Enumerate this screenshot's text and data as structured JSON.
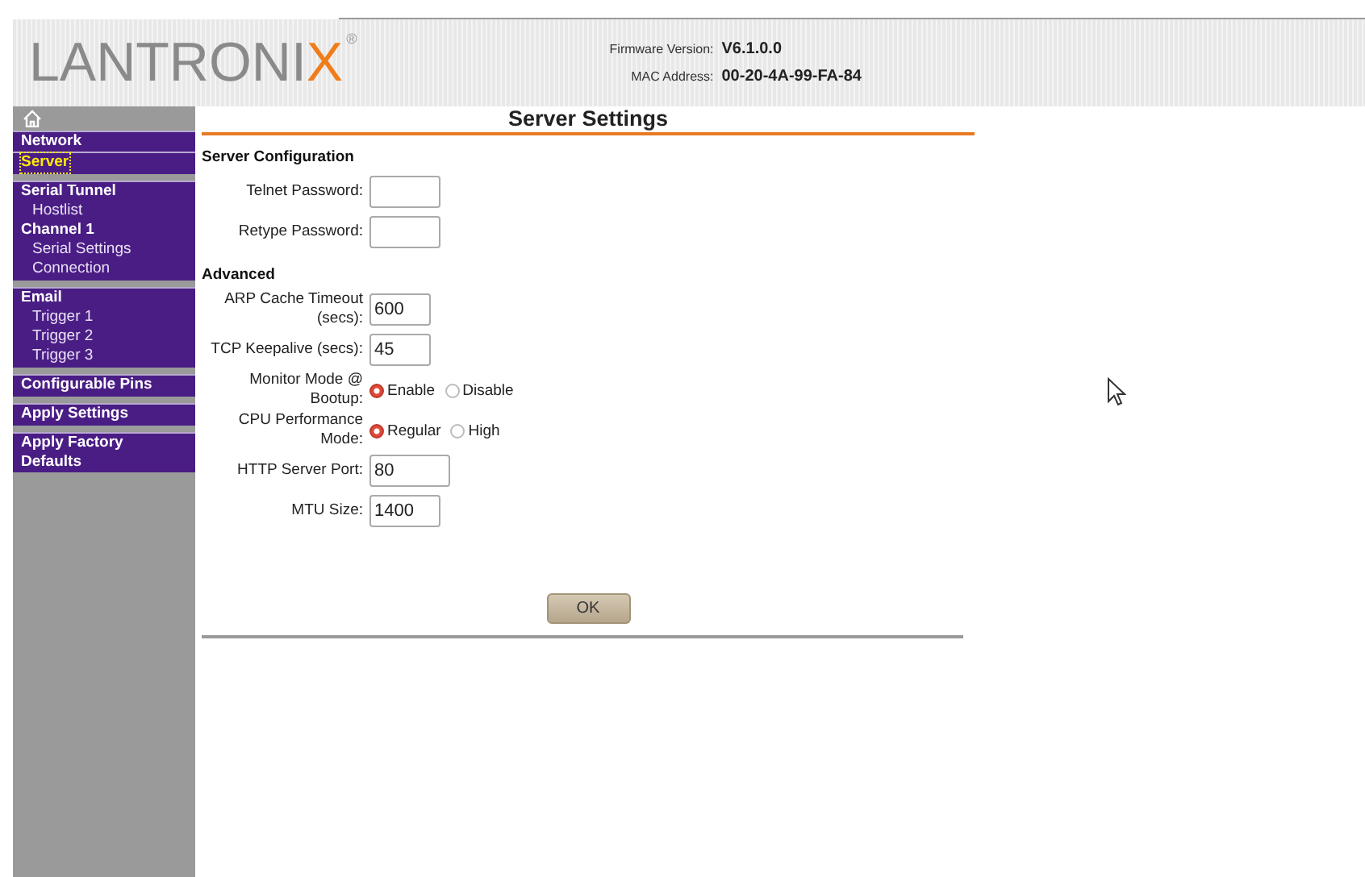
{
  "logo": {
    "text": "LANTRONI",
    "accent": "X",
    "mark": "®"
  },
  "device_info": [
    {
      "label": "Firmware Version:",
      "value": "V6.1.0.0"
    },
    {
      "label": "MAC Address:",
      "value": "00-20-4A-99-FA-84"
    }
  ],
  "sidebar": {
    "sections": [
      {
        "items": [
          {
            "label": "Network",
            "kind": "heading",
            "selected": false
          },
          {
            "label": "Server",
            "kind": "heading",
            "selected": true
          }
        ]
      },
      {
        "items": [
          {
            "label": "Serial Tunnel",
            "kind": "heading",
            "selected": false
          },
          {
            "label": "Hostlist",
            "kind": "sub",
            "selected": false
          },
          {
            "label": "Channel 1",
            "kind": "heading",
            "selected": false
          },
          {
            "label": "Serial Settings",
            "kind": "sub",
            "selected": false
          },
          {
            "label": "Connection",
            "kind": "sub",
            "selected": false
          }
        ]
      },
      {
        "items": [
          {
            "label": "Email",
            "kind": "heading",
            "selected": false
          },
          {
            "label": "Trigger 1",
            "kind": "sub",
            "selected": false
          },
          {
            "label": "Trigger 2",
            "kind": "sub",
            "selected": false
          },
          {
            "label": "Trigger 3",
            "kind": "sub",
            "selected": false
          }
        ]
      },
      {
        "items": [
          {
            "label": "Configurable Pins",
            "kind": "heading",
            "selected": false
          }
        ]
      },
      {
        "items": [
          {
            "label": "Apply Settings",
            "kind": "heading",
            "selected": false
          }
        ]
      },
      {
        "items": [
          {
            "label": "Apply Factory Defaults",
            "kind": "heading",
            "selected": false
          }
        ]
      }
    ]
  },
  "page_title": "Server Settings",
  "sections": [
    {
      "title": "Server Configuration",
      "rows": [
        {
          "kind": "text",
          "label": "Telnet Password:"
        },
        {
          "kind": "text",
          "label": "Retype Password:"
        }
      ]
    },
    {
      "title": "Advanced",
      "rows": [
        {
          "kind": "text",
          "label": "ARP Cache Timeout (secs):",
          "value": "600"
        },
        {
          "kind": "text",
          "label": "TCP Keepalive (secs):",
          "value": "45"
        },
        {
          "kind": "radio",
          "label": "Monitor Mode @ Bootup:",
          "options": [
            {
              "label": "Enable",
              "selected": true
            },
            {
              "label": "Disable",
              "selected": false
            }
          ]
        },
        {
          "kind": "radio",
          "label": "CPU Performance Mode:",
          "options": [
            {
              "label": "Regular",
              "selected": true
            },
            {
              "label": "High",
              "selected": false
            }
          ]
        },
        {
          "kind": "text",
          "label": "HTTP Server Port:",
          "value": "80"
        },
        {
          "kind": "text",
          "label": "MTU Size:",
          "value": "1400"
        }
      ]
    }
  ],
  "ok_button": "OK"
}
